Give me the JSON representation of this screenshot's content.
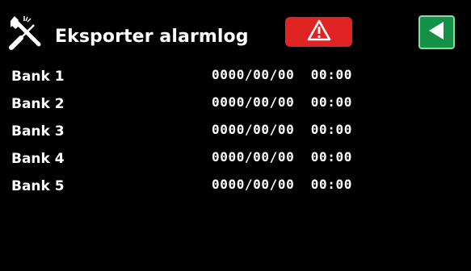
{
  "header": {
    "title": "Eksporter alarmlog",
    "tools_icon": "tools-icon",
    "alarm_icon": "warning-triangle-icon",
    "back_icon": "back-arrow-icon",
    "colors": {
      "alarm_button": "#e02424",
      "back_button": "#149147",
      "back_button_border": "#8fd6a5",
      "background": "#000000",
      "text": "#ffffff"
    }
  },
  "banks": [
    {
      "label": "Bank 1",
      "date": "0000/00/00  00:00"
    },
    {
      "label": "Bank 2",
      "date": "0000/00/00  00:00"
    },
    {
      "label": "Bank 3",
      "date": "0000/00/00  00:00"
    },
    {
      "label": "Bank 4",
      "date": "0000/00/00  00:00"
    },
    {
      "label": "Bank 5",
      "date": "0000/00/00  00:00"
    }
  ]
}
